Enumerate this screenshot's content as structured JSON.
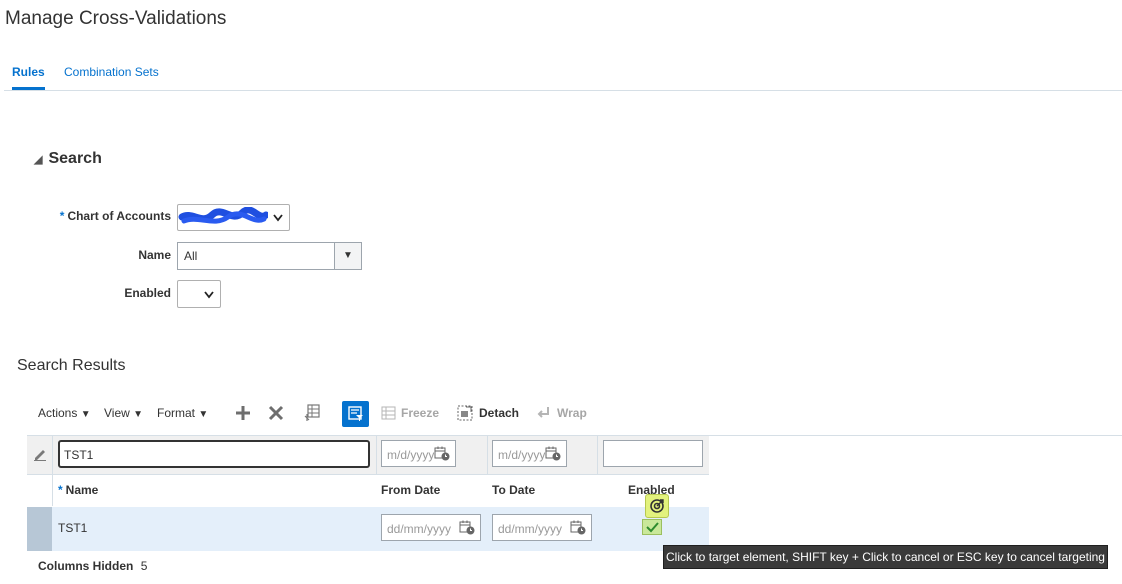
{
  "page": {
    "title": "Manage Cross-Validations"
  },
  "tabs": [
    {
      "label": "Rules",
      "active": true
    },
    {
      "label": "Combination Sets",
      "active": false
    }
  ],
  "search": {
    "title": "Search",
    "fields": {
      "chart_of_accounts": {
        "label": "Chart of Accounts",
        "required": true,
        "value": ""
      },
      "name": {
        "label": "Name",
        "value": "All"
      },
      "enabled": {
        "label": "Enabled",
        "value": ""
      }
    }
  },
  "results": {
    "title": "Search Results",
    "toolbar": {
      "actions": "Actions",
      "view": "View",
      "format": "Format",
      "freeze": "Freeze",
      "detach": "Detach",
      "wrap": "Wrap"
    },
    "filter_row": {
      "name_value": "TST1",
      "from_date_placeholder": "m/d/yyyy",
      "to_date_placeholder": "m/d/yyyy",
      "enabled_value": ""
    },
    "columns": {
      "name": "Name",
      "from_date": "From Date",
      "to_date": "To Date",
      "enabled": "Enabled"
    },
    "rows": [
      {
        "name": "TST1",
        "from_date_placeholder": "dd/mm/yyyy",
        "to_date_placeholder": "dd/mm/yyyy",
        "enabled": true
      }
    ],
    "columns_hidden_label": "Columns Hidden",
    "columns_hidden_count": "5"
  },
  "tooltip": {
    "text": "Click to target element, SHIFT key + Click to cancel or ESC key to cancel targeting"
  },
  "colors": {
    "accent": "#0572ce",
    "row_selected": "#e4effa",
    "tooltip_bg": "#3a3a3a"
  }
}
